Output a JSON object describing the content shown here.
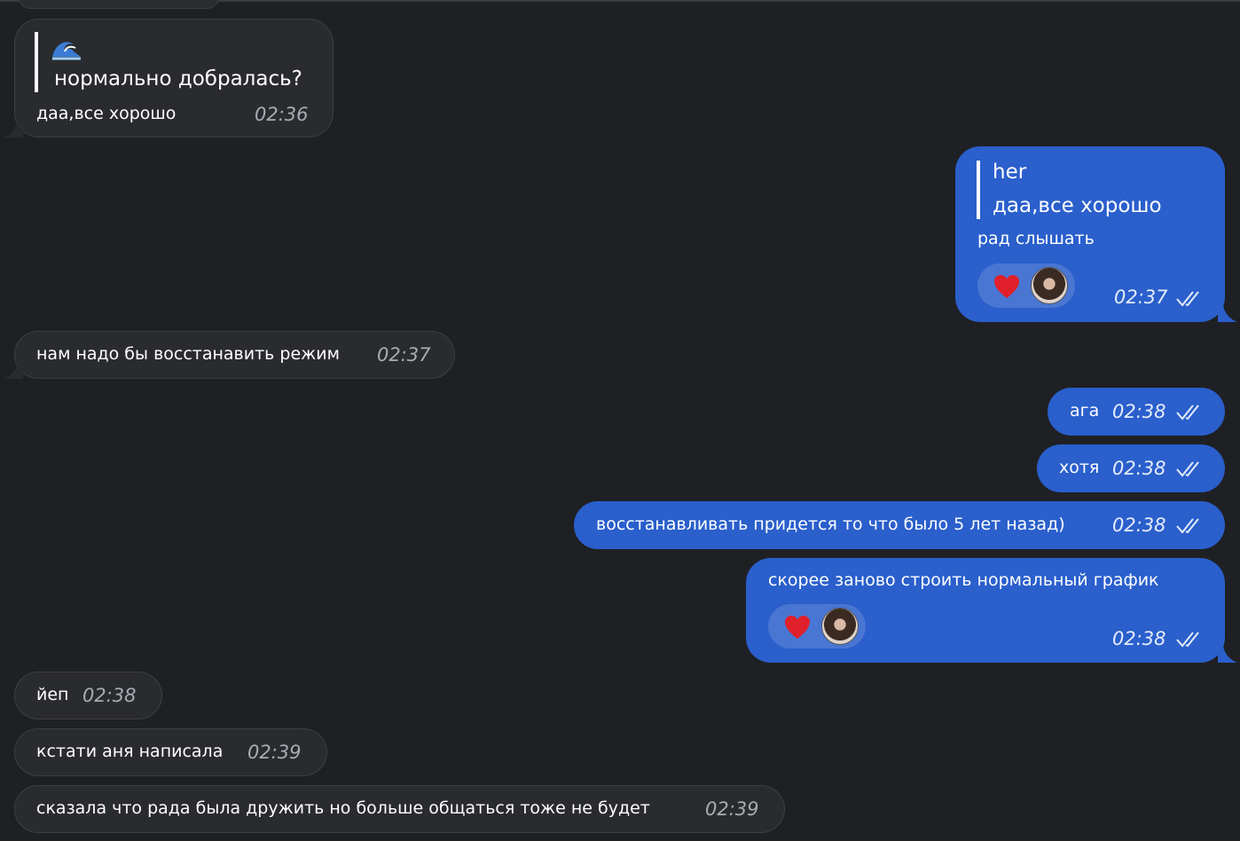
{
  "messages": [
    {
      "id": "m1",
      "dir": "in",
      "reply_icon": "wave-emoji-icon",
      "reply_text": "нормально добралась?",
      "text": "даа,все хорошо",
      "time": "02:36"
    },
    {
      "id": "m2",
      "dir": "out",
      "reply_author": "her",
      "reply_text": "даа,все хорошо",
      "text": "рад слышать",
      "time": "02:37",
      "reactions": [
        "heart-icon",
        "reactor-avatar"
      ]
    },
    {
      "id": "m3",
      "dir": "in",
      "text": "нам надо бы восстанавить режим",
      "time": "02:37"
    },
    {
      "id": "m4",
      "dir": "out",
      "text": "ага",
      "time": "02:38"
    },
    {
      "id": "m5",
      "dir": "out",
      "text": "хотя",
      "time": "02:38"
    },
    {
      "id": "m6",
      "dir": "out",
      "text": "восстанавливать придется то что было 5 лет назад)",
      "time": "02:38"
    },
    {
      "id": "m7",
      "dir": "out",
      "text": "скорее заново строить нормальный график",
      "time": "02:38",
      "reactions": [
        "heart-icon",
        "reactor-avatar"
      ]
    },
    {
      "id": "m8",
      "dir": "in",
      "text": "йеп",
      "time": "02:38"
    },
    {
      "id": "m9",
      "dir": "in",
      "text": "кстати аня написала",
      "time": "02:39"
    },
    {
      "id": "m10",
      "dir": "in",
      "text": "сказала что рада была дружить но больше общаться тоже не будет",
      "time": "02:39"
    }
  ],
  "colors": {
    "background": "#1e2024",
    "incoming_bubble": "#2a2b2f",
    "outgoing_bubble": "#2a5fcc",
    "heart": "#e0202a"
  }
}
